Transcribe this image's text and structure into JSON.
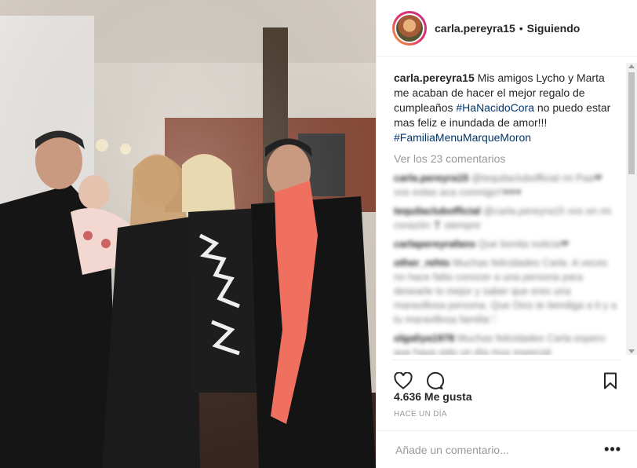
{
  "post": {
    "username": "carla.pereyra15",
    "separator": "•",
    "follow_label": "Siguiendo"
  },
  "caption": {
    "username": "carla.pereyra15",
    "text_1": "Mis amigos Lycho y Marta me acaban de hacer el mejor regalo de cumpleaños ",
    "hashtag_1": "#HaNacidoCora",
    "text_2": " no puedo estar mas feliz e inundada de amor!!! ",
    "hashtag_2": "#FamiliaMenuMarqueMoron"
  },
  "view_comments": "Ver los 23 comentarios",
  "comments": [
    {
      "user": "carla.pereyra15",
      "text": "@tequilaclubofficial mi Paa❤ vos estas aca conmigo!!♥♥♥"
    },
    {
      "user": "tequilaclubofficial",
      "text": "@carla.pereyra15 vos en mi corazón ❣ siempre"
    },
    {
      "user": "carlapereyrafans",
      "text": "Que bonita noticia❤"
    },
    {
      "user": "other_rehts",
      "text": "Muchas felicidades Carla. A veces no hace falta conocer a una persona para desearle lo mejor y saber que eres una maravillosa persona. Que Dios te bendiga a ti y a tu maravillosa familia♡"
    },
    {
      "user": "olgaliya1978",
      "text": "Muchas felicidades Carla espero que haya sido un día muy especial."
    }
  ],
  "likes": "4.636 Me gusta",
  "timestamp": "HACE UN DÍA",
  "add_comment": {
    "placeholder": "Añade un comentario..."
  },
  "more_label": "•••",
  "icons": {
    "like": "heart-icon",
    "comment": "comment-icon",
    "save": "bookmark-icon"
  }
}
